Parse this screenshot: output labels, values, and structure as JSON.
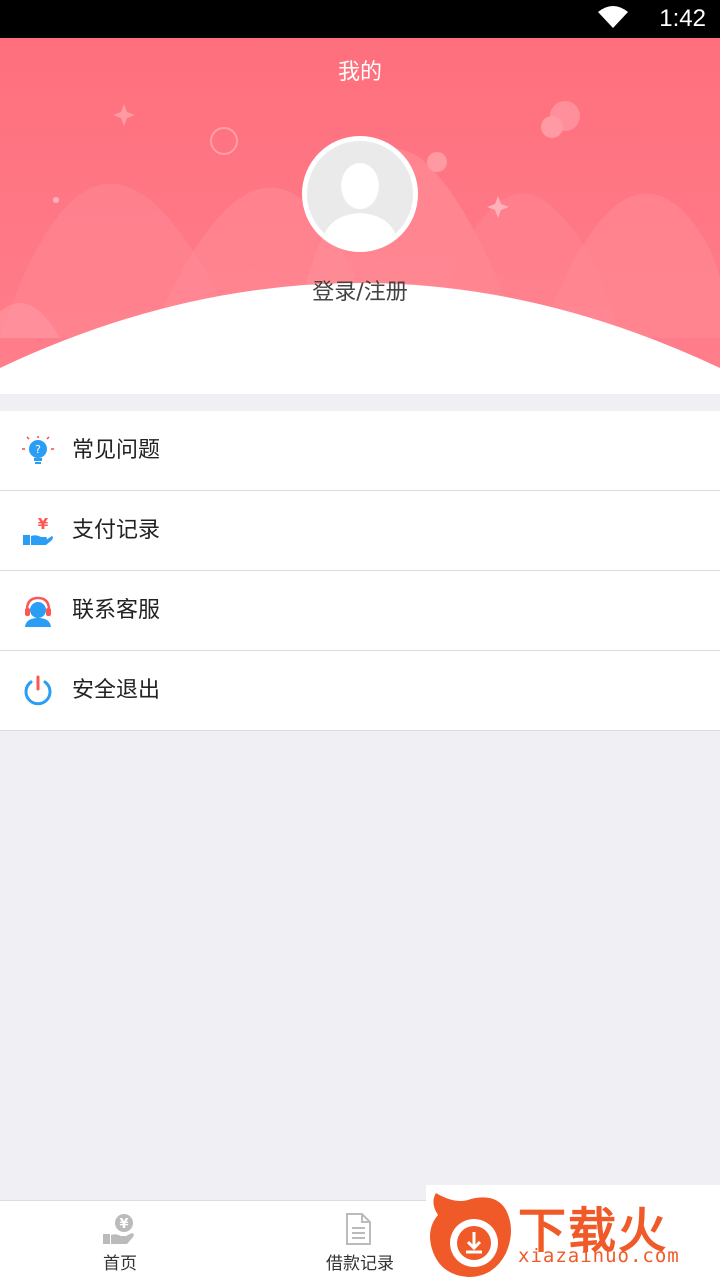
{
  "status": {
    "time": "1:42"
  },
  "header": {
    "title": "我的",
    "login_label": "登录/注册",
    "bg_color": "#ff6b7b"
  },
  "menu": {
    "items": [
      {
        "label": "常见问题",
        "icon": "lightbulb-question-icon"
      },
      {
        "label": "支付记录",
        "icon": "hand-yuan-icon"
      },
      {
        "label": "联系客服",
        "icon": "headset-agent-icon"
      },
      {
        "label": "安全退出",
        "icon": "power-icon"
      }
    ]
  },
  "tabbar": {
    "tabs": [
      {
        "label": "首页",
        "icon": "hand-yuan-icon"
      },
      {
        "label": "借款记录",
        "icon": "document-icon"
      }
    ]
  },
  "watermark": {
    "brand": "下载火",
    "url": "xiazaihuo.com"
  }
}
